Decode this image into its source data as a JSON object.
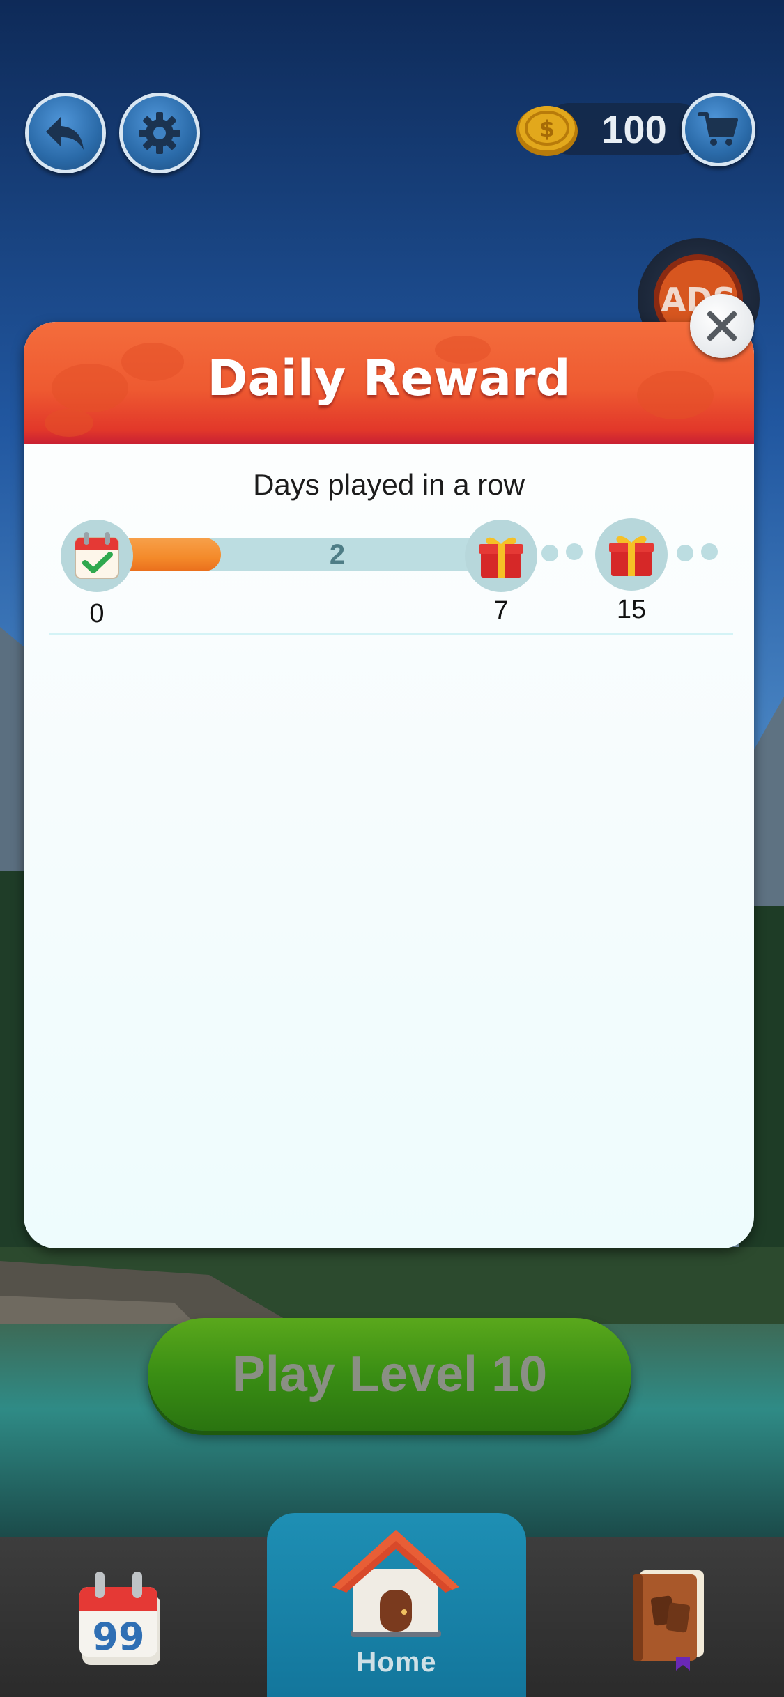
{
  "top_bar": {
    "back_icon": "back-arrow-icon",
    "settings_icon": "gear-icon",
    "coin_icon": "coin-icon",
    "coins": "100",
    "cart_icon": "cart-icon"
  },
  "ads_button": {
    "label": "ADS",
    "icon": "no-ads-icon"
  },
  "daily_reward": {
    "title": "Daily Reward",
    "subtitle": "Days played in a row",
    "progress": {
      "current": "2",
      "value": 2,
      "max": 7,
      "start_label": "0",
      "milestones": [
        {
          "day": "7",
          "icon": "gift-icon"
        },
        {
          "day": "15",
          "icon": "gift-icon"
        }
      ],
      "start_icon": "calendar-check-icon"
    },
    "close_icon": "close-icon"
  },
  "play_button": {
    "label": "Play Level 10"
  },
  "bottom_nav": {
    "items": [
      {
        "name": "daily-quotes",
        "icon": "calendar-quote-icon",
        "label": ""
      },
      {
        "name": "home",
        "icon": "house-icon",
        "label": "Home"
      },
      {
        "name": "collection",
        "icon": "book-icon",
        "label": ""
      }
    ]
  },
  "colors": {
    "header_orange": "#ee5a31",
    "progress_fill": "#f48a2a",
    "play_green": "#3a8e14",
    "home_tab": "#1e8fb4"
  }
}
